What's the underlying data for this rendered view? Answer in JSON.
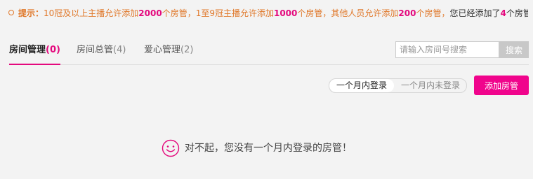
{
  "tip": {
    "label": "提示：",
    "p1": "10冠及以上主播允许添加",
    "n1": "2000",
    "p2": "个房管，1至9冠主播允许添加",
    "n2": "1000",
    "p3": "个房管，其他人员允许添加",
    "n3": "200",
    "p4": "个房管，",
    "p5": "您已经添加了",
    "n4": "4",
    "p6": "个房管"
  },
  "tabs": [
    {
      "label": "房间管理",
      "count": "(0)",
      "active": true
    },
    {
      "label": "房间总管",
      "count": "(4)",
      "active": false
    },
    {
      "label": "爱心管理",
      "count": "(2)",
      "active": false
    }
  ],
  "search": {
    "placeholder": "请输入房间号搜索",
    "button": "搜索"
  },
  "filter": {
    "logged_in": "一个月内登录",
    "not_logged_in": "一个月内未登录"
  },
  "add_button": "添加房管",
  "empty_message": "对不起，您没有一个月内登录的房管！",
  "colors": {
    "accent": "#f0048c",
    "tip": "#e0782a"
  },
  "icons": {
    "tip": "circle-bullet-icon",
    "empty": "smiley-icon"
  }
}
